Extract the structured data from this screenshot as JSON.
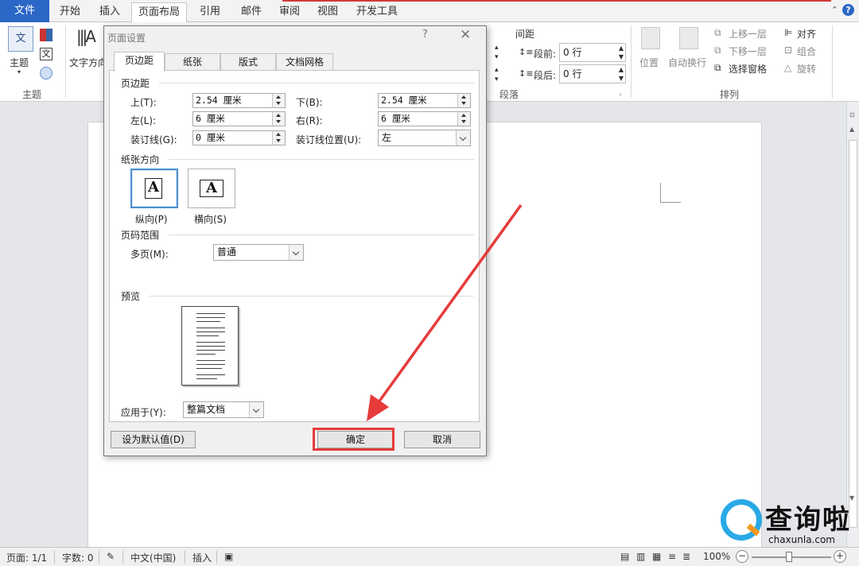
{
  "ribbon_tabs": [
    "文件",
    "开始",
    "插入",
    "页面布局",
    "引用",
    "邮件",
    "审阅",
    "视图",
    "开发工具"
  ],
  "active_tab": "页面布局",
  "ribbon": {
    "theme_group": {
      "label": "主题",
      "button": "主题",
      "icon_text": "文"
    },
    "text_direction": "文字方向",
    "spacing": {
      "heading": "间距",
      "before_label": "段前:",
      "before_value": "0 行",
      "after_label": "段后:",
      "after_value": "0 行"
    },
    "paragraph_group": "段落",
    "arrange": {
      "position": "位置",
      "wrap": "自动换行",
      "bring_forward": "上移一层",
      "send_backward": "下移一层",
      "selection_pane": "选择窗格",
      "align": "对齐",
      "group": "组合",
      "rotate": "旋转",
      "group_label": "排列"
    }
  },
  "dialog": {
    "title": "页面设置",
    "help": "?",
    "close": "✕",
    "tabs": [
      "页边距",
      "纸张",
      "版式",
      "文档网格"
    ],
    "margins": {
      "section": "页边距",
      "top_label": "上(T):",
      "top_value": "2.54 厘米",
      "bottom_label": "下(B):",
      "bottom_value": "2.54 厘米",
      "left_label": "左(L):",
      "left_value": "6 厘米",
      "right_label": "右(R):",
      "right_value": "6 厘米",
      "gutter_label": "装订线(G):",
      "gutter_value": "0 厘米",
      "gutter_pos_label": "装订线位置(U):",
      "gutter_pos_value": "左"
    },
    "orientation": {
      "section": "纸张方向",
      "portrait": "纵向(P)",
      "landscape": "横向(S)",
      "glyph": "A"
    },
    "pages": {
      "section": "页码范围",
      "multiple_label": "多页(M):",
      "multiple_value": "普通"
    },
    "preview": {
      "section": "预览"
    },
    "apply": {
      "label": "应用于(Y):",
      "value": "整篇文档"
    },
    "buttons": {
      "default": "设为默认值(D)",
      "ok": "确定",
      "cancel": "取消"
    }
  },
  "status": {
    "page": "页面: 1/1",
    "words": "字数: 0",
    "language": "中文(中国)",
    "mode": "插入",
    "zoom": "100%",
    "zoom_level": 1.0
  },
  "watermark": {
    "text": "查询啦",
    "url": "chaxunla.com"
  },
  "colors": {
    "file_tab": "#2b67c6",
    "highlight": "#e63b3b",
    "selected_border": "#4b8fd0"
  }
}
